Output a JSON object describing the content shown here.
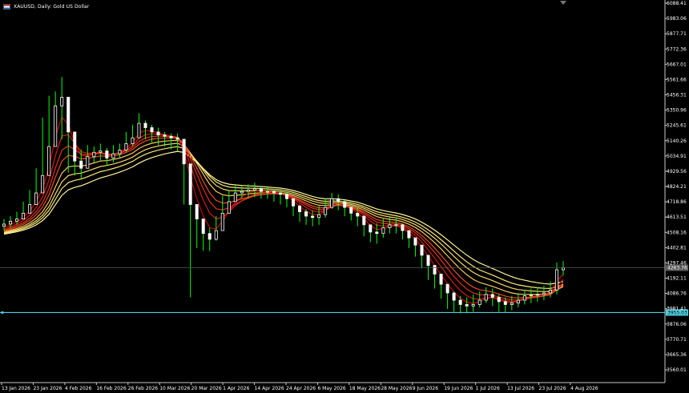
{
  "header": {
    "title": "XAUUSD, Daily: Gold US Dollar",
    "flag_icon": "us-flag-icon"
  },
  "chart_data": {
    "type": "candlestick",
    "symbol": "XAUUSD",
    "timeframe": "Daily",
    "description": "Gold US Dollar",
    "y_ticks": [
      "6088.41",
      "5983.06",
      "5877.71",
      "5772.36",
      "5667.01",
      "5561.66",
      "5456.31",
      "5350.96",
      "5245.61",
      "5140.26",
      "5034.91",
      "4929.56",
      "4824.21",
      "4718.86",
      "4613.51",
      "4508.16",
      "4402.81",
      "4297.46",
      "4192.11",
      "4086.76",
      "3981.41",
      "3876.06",
      "3770.71",
      "3665.36",
      "3560.01"
    ],
    "ylim": [
      3455,
      6100
    ],
    "x_ticks": [
      "13 Jan 2026",
      "23 Jan 2026",
      "4 Feb 2026",
      "16 Feb 2026",
      "26 Feb 2026",
      "10 Mar 2026",
      "20 Mar 2026",
      "1 Apr 2026",
      "14 Apr 2026",
      "24 Apr 2026",
      "6 May 2026",
      "18 May 2026",
      "28 May 2026",
      "9 Jun 2026",
      "19 Jun 2026",
      "1 Jul 2026",
      "13 Jul 2026",
      "23 Jul 2026",
      "4 Aug 2026"
    ],
    "price_label": "4263.76",
    "support_level": "3955.03",
    "support_value": 3955.03,
    "current_value": 4263.76,
    "colors": {
      "bull": "#ffffff",
      "bear": "#ffffff",
      "wick": "#00ff00",
      "support_line": "#4dd0e1",
      "price_line": "#5a5a5a",
      "ma_fast": [
        "#cc0000",
        "#d81b10",
        "#e53020",
        "#ef4a28"
      ],
      "ma_slow": [
        "#f6c760",
        "#f8d96a",
        "#fbe97a",
        "#fff59a"
      ]
    },
    "closes": [
      4565,
      4585,
      4600,
      4640,
      4700,
      4780,
      4900,
      5100,
      5380,
      5440,
      5200,
      5000,
      4950,
      5030,
      5060,
      5070,
      5020,
      5050,
      5075,
      5120,
      5160,
      5260,
      5230,
      5200,
      5180,
      5170,
      5160,
      5150,
      4980,
      4700,
      4600,
      4500,
      4460,
      4520,
      4640,
      4720,
      4780,
      4790,
      4800,
      4810,
      4790,
      4790,
      4780,
      4770,
      4740,
      4690,
      4650,
      4620,
      4610,
      4630,
      4680,
      4740,
      4720,
      4680,
      4640,
      4620,
      4560,
      4510,
      4500,
      4540,
      4560,
      4560,
      4520,
      4470,
      4420,
      4350,
      4280,
      4220,
      4150,
      4090,
      4040,
      4010,
      4000,
      4010,
      4040,
      4080,
      4060,
      4030,
      4010,
      4020,
      4040,
      4070,
      4075,
      4080,
      4090,
      4110,
      4250,
      4263.76
    ],
    "highs": [
      4600,
      4620,
      4650,
      4720,
      4800,
      4950,
      5300,
      5450,
      5480,
      5580,
      5330,
      5120,
      5080,
      5110,
      5100,
      5120,
      5090,
      5110,
      5120,
      5200,
      5250,
      5330,
      5280,
      5250,
      5230,
      5200,
      5190,
      5190,
      5060,
      4800,
      4700,
      4560,
      4540,
      4620,
      4760,
      4800,
      4830,
      4830,
      4840,
      4850,
      4830,
      4820,
      4810,
      4800,
      4790,
      4740,
      4700,
      4670,
      4660,
      4690,
      4740,
      4780,
      4770,
      4730,
      4690,
      4680,
      4620,
      4560,
      4570,
      4600,
      4610,
      4610,
      4570,
      4520,
      4470,
      4410,
      4330,
      4280,
      4220,
      4150,
      4100,
      4070,
      4060,
      4080,
      4100,
      4130,
      4120,
      4080,
      4060,
      4070,
      4090,
      4110,
      4120,
      4130,
      4140,
      4170,
      4300,
      4310
    ],
    "lows": [
      4520,
      4540,
      4560,
      4600,
      4650,
      4700,
      4820,
      4980,
      5250,
      5150,
      4920,
      4900,
      4880,
      4970,
      4990,
      5000,
      4970,
      4990,
      5020,
      5060,
      5100,
      5180,
      5150,
      5120,
      5110,
      5100,
      5080,
      5070,
      4700,
      4060,
      4400,
      4380,
      4380,
      4450,
      4550,
      4650,
      4720,
      4740,
      4740,
      4750,
      4740,
      4740,
      4720,
      4700,
      4680,
      4620,
      4580,
      4560,
      4550,
      4560,
      4610,
      4670,
      4660,
      4620,
      4590,
      4550,
      4480,
      4440,
      4430,
      4470,
      4500,
      4500,
      4460,
      4400,
      4340,
      4260,
      4180,
      4120,
      4050,
      3980,
      3960,
      3950,
      3950,
      3960,
      3990,
      4020,
      4000,
      3960,
      3955,
      3970,
      3990,
      4010,
      4020,
      4030,
      4040,
      4060,
      4080,
      4210
    ]
  }
}
